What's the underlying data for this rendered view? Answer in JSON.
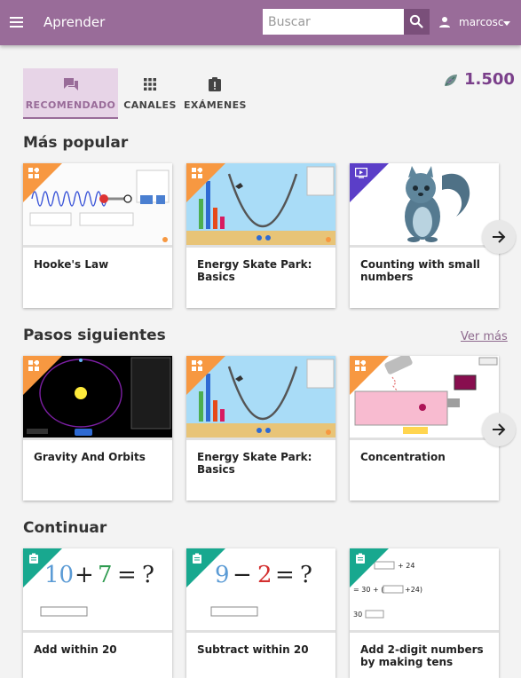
{
  "header": {
    "app_title": "Aprender",
    "search_placeholder": "Buscar",
    "user_name": "marcosc"
  },
  "tabs": [
    {
      "label": "RECOMENDADO",
      "icon": "forum-icon",
      "active": true
    },
    {
      "label": "CANALES",
      "icon": "apps-grid-icon",
      "active": false
    },
    {
      "label": "EXÁMENES",
      "icon": "assignment-late-icon",
      "active": false
    }
  ],
  "points": {
    "value": "1.500",
    "icon": "points-leaf-icon",
    "color": "#7a3f8a"
  },
  "sections": [
    {
      "title": "Más popular",
      "see_more": "",
      "cards": [
        {
          "title": "Hooke's Law",
          "kind": "simulation"
        },
        {
          "title": "Energy Skate Park: Basics",
          "kind": "simulation"
        },
        {
          "title": "Counting with small numbers",
          "kind": "video"
        }
      ]
    },
    {
      "title": "Pasos siguientes",
      "see_more": "Ver más",
      "cards": [
        {
          "title": "Gravity And Orbits",
          "kind": "simulation"
        },
        {
          "title": "Energy Skate Park: Basics",
          "kind": "simulation"
        },
        {
          "title": "Concentration",
          "kind": "simulation"
        }
      ]
    },
    {
      "title": "Continuar",
      "see_more": "",
      "cards": [
        {
          "title": "Add within 20",
          "kind": "exercise",
          "thumb_text": {
            "a": "10",
            "op": "+",
            "b": "7",
            "eq": "=",
            "q": "?"
          }
        },
        {
          "title": "Subtract within 20",
          "kind": "exercise",
          "thumb_text": {
            "a": "9",
            "op": "−",
            "b": "2",
            "eq": "=",
            "q": "?"
          }
        },
        {
          "title": "Add 2-digit numbers by making tens",
          "kind": "exercise",
          "thumb_text": {
            "l1a": "30 +",
            "l1b": "+ 24",
            "l2a": "= 30 + (",
            "l2b": "+24)",
            "l3a": "30 +"
          }
        }
      ]
    }
  ],
  "colors": {
    "header": "#996c99",
    "simulation_corner": "#f79841",
    "video_corner": "#5b3ec8",
    "exercise_corner": "#18a88f"
  }
}
